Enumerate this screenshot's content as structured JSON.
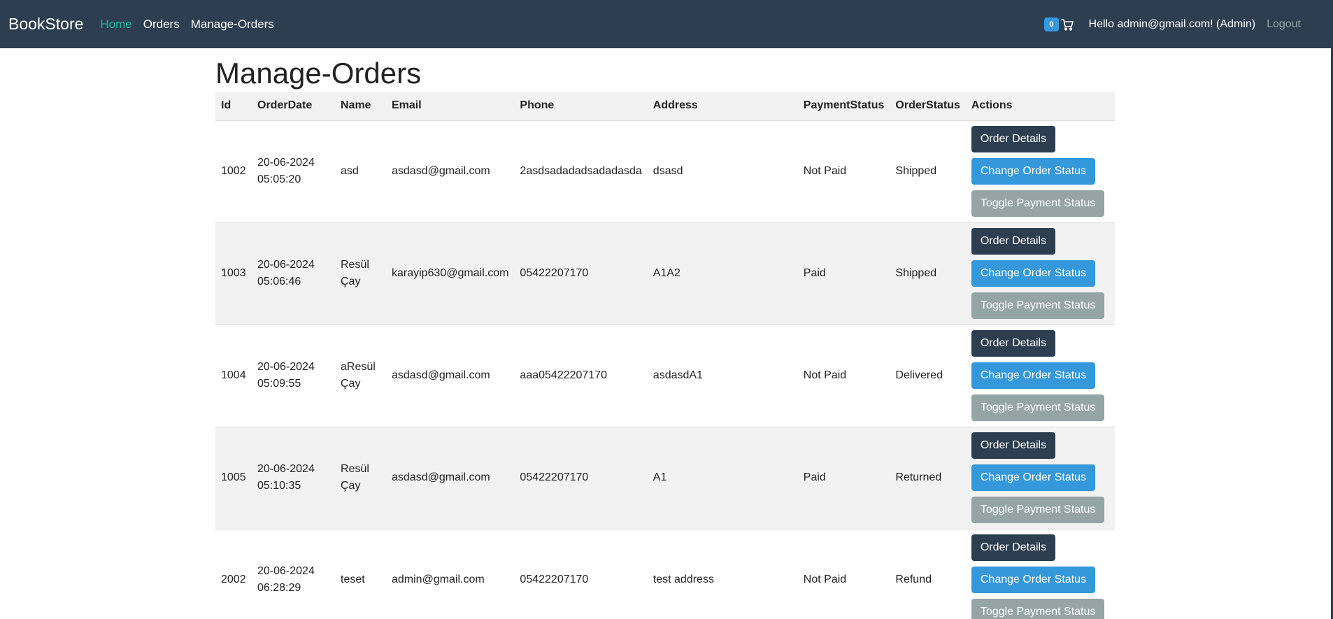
{
  "navbar": {
    "brand": "BookStore",
    "links": [
      {
        "label": "Home",
        "active": true
      },
      {
        "label": "Orders",
        "active": false
      },
      {
        "label": "Manage-Orders",
        "active": false
      }
    ],
    "cart_count": "0",
    "cart_icon": "cart-icon",
    "greeting": "Hello admin@gmail.com! (Admin)",
    "logout": "Logout"
  },
  "page": {
    "title": "Manage-Orders"
  },
  "table": {
    "headers": [
      "Id",
      "OrderDate",
      "Name",
      "Email",
      "Phone",
      "Address",
      "PaymentStatus",
      "OrderStatus",
      "Actions"
    ],
    "rows": [
      {
        "id": "1002",
        "date": "20-06-2024",
        "time": "05:05:20",
        "name1": "asd",
        "name2": "",
        "email": "asdasd@gmail.com",
        "phone": "2asdsadadadsadadasda",
        "address": "dsasd",
        "payment": "Not Paid",
        "status": "Shipped"
      },
      {
        "id": "1003",
        "date": "20-06-2024",
        "time": "05:06:46",
        "name1": "Resül",
        "name2": "Çay",
        "email": "karayip630@gmail.com",
        "phone": "05422207170",
        "address": "A1A2",
        "payment": "Paid",
        "status": "Shipped"
      },
      {
        "id": "1004",
        "date": "20-06-2024",
        "time": "05:09:55",
        "name1": "aResül",
        "name2": "Çay",
        "email": "asdasd@gmail.com",
        "phone": "aaa05422207170",
        "address": "asdasdA1",
        "payment": "Not Paid",
        "status": "Delivered"
      },
      {
        "id": "1005",
        "date": "20-06-2024",
        "time": "05:10:35",
        "name1": "Resül",
        "name2": "Çay",
        "email": "asdasd@gmail.com",
        "phone": "05422207170",
        "address": "A1",
        "payment": "Paid",
        "status": "Returned"
      },
      {
        "id": "2002",
        "date": "20-06-2024",
        "time": "06:28:29",
        "name1": "teset",
        "name2": "",
        "email": "admin@gmail.com",
        "phone": "05422207170",
        "address": "test address",
        "payment": "Not Paid",
        "status": "Refund"
      }
    ],
    "actions": {
      "details": "Order Details",
      "change_status": "Change Order Status",
      "toggle_payment": "Toggle Payment Status"
    }
  },
  "colors": {
    "navbar": "#2c3e50",
    "active_link": "#18bc9c",
    "primary": "#3498db",
    "secondary": "#95a5a6",
    "dark": "#2c3e50"
  }
}
